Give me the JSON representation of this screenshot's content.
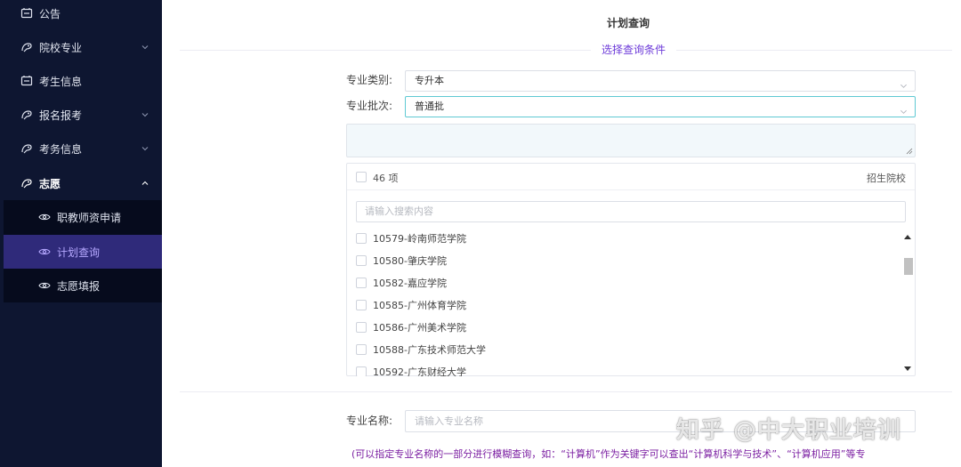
{
  "sidebar": {
    "items": [
      {
        "label": "公告",
        "icon": "notice-icon",
        "has_arrow": false
      },
      {
        "label": "院校专业",
        "icon": "school-icon",
        "has_arrow": true
      },
      {
        "label": "考生信息",
        "icon": "profile-icon",
        "has_arrow": false
      },
      {
        "label": "报名报考",
        "icon": "register-icon",
        "has_arrow": true
      },
      {
        "label": "考务信息",
        "icon": "exam-icon",
        "has_arrow": true
      },
      {
        "label": "志愿",
        "icon": "wish-icon",
        "has_arrow": true,
        "expanded": true
      }
    ],
    "sub_items": [
      {
        "label": "职教师资申请",
        "icon": "eye-icon"
      },
      {
        "label": "计划查询",
        "icon": "eye-icon",
        "active": true
      },
      {
        "label": "志愿填报",
        "icon": "eye-icon"
      }
    ]
  },
  "main": {
    "title": "计划查询",
    "section_title": "选择查询条件",
    "category_label": "专业类别:",
    "category_value": "专升本",
    "batch_label": "专业批次:",
    "batch_value": "普通批",
    "panel": {
      "count_text": "46 项",
      "header_right": "招生院校",
      "search_placeholder": "请输入搜索内容",
      "items": [
        "10579-岭南师范学院",
        "10580-肇庆学院",
        "10582-嘉应学院",
        "10585-广州体育学院",
        "10586-广州美术学院",
        "10588-广东技术师范大学",
        "10592-广东财经大学"
      ]
    },
    "name_label": "专业名称:",
    "name_placeholder": "请输入专业名称",
    "hint": "(可以指定专业名称的一部分进行模糊查询，如：“计算机”作为关键字可以查出“计算机科学与技术”、“计算机应用”等专"
  },
  "watermark": "知乎 @中大职业培训",
  "colors": {
    "sidebar_bg": "#0e1631",
    "submenu_bg": "#060b1d",
    "active_bg": "#2f2a7a",
    "accent": "#6d3bd9",
    "hint": "#7b1fa2",
    "focus": "#5fc9d3"
  }
}
